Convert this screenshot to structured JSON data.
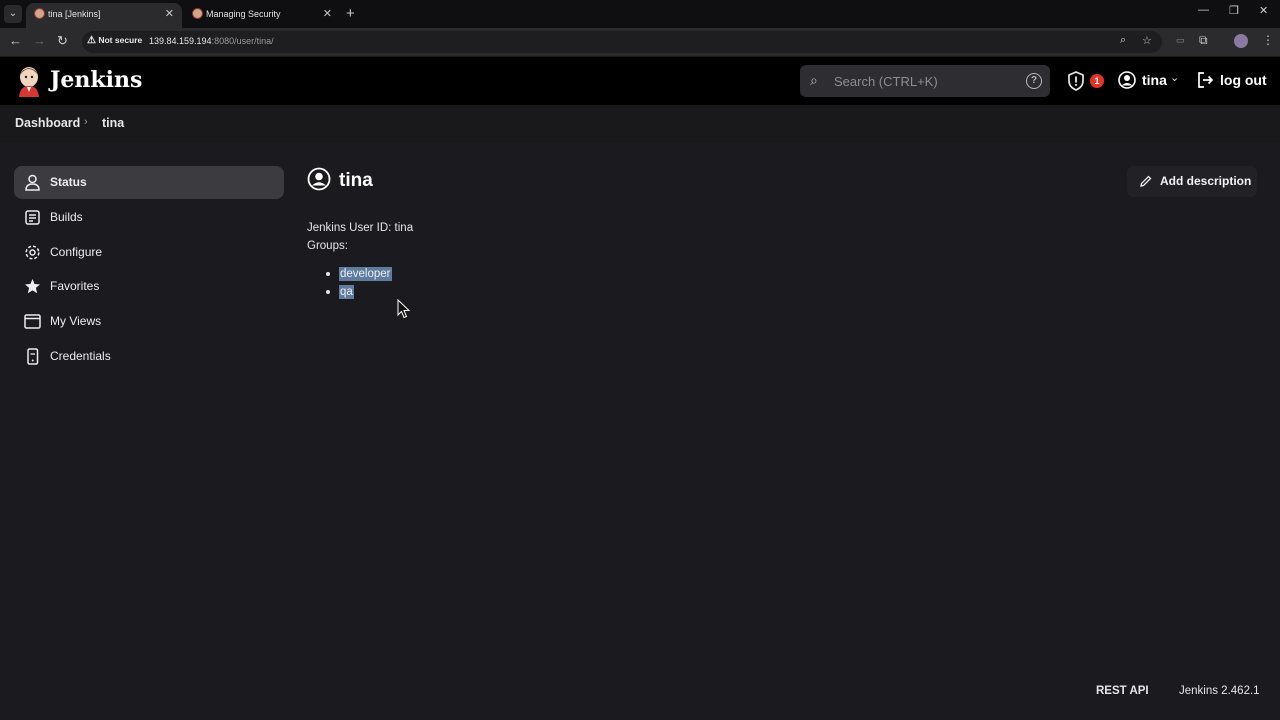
{
  "browser": {
    "tabs": [
      {
        "title": "tina [Jenkins]",
        "active": true
      },
      {
        "title": "Managing Security",
        "active": false
      }
    ],
    "security_label": "Not secure",
    "url_host": "139.84.159.194",
    "url_rest": ":8080/user/tina/"
  },
  "header": {
    "brand": "Jenkins",
    "search_placeholder": "Search (CTRL+K)",
    "alert_count": "1",
    "user_name": "tina",
    "logout_label": "log out"
  },
  "breadcrumb": {
    "items": [
      "Dashboard",
      "tina"
    ]
  },
  "sidebar": {
    "items": [
      {
        "label": "Status",
        "icon": "person-icon",
        "active": true
      },
      {
        "label": "Builds",
        "icon": "builds-icon",
        "active": false
      },
      {
        "label": "Configure",
        "icon": "gear-icon",
        "active": false
      },
      {
        "label": "Favorites",
        "icon": "star-icon",
        "active": false
      },
      {
        "label": "My Views",
        "icon": "window-icon",
        "active": false
      },
      {
        "label": "Credentials",
        "icon": "phone-icon",
        "active": false
      }
    ]
  },
  "main": {
    "title": "tina",
    "add_description_label": "Add description",
    "user_id_line": "Jenkins User ID: tina",
    "groups_label": "Groups:",
    "groups": [
      "developer",
      "qa"
    ]
  },
  "footer": {
    "rest_api": "REST API",
    "version": "Jenkins 2.462.1"
  },
  "colors": {
    "page_bg": "#1b1b1f",
    "header_bg": "#000000",
    "active_item_bg": "#3b3b40",
    "selection_bg": "#5f7c9e",
    "badge_red": "#e5332a"
  }
}
